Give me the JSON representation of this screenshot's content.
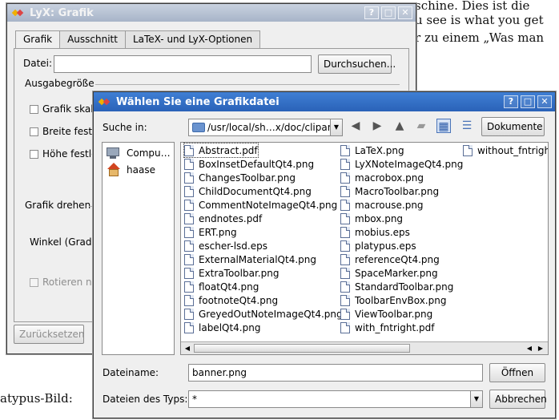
{
  "background_doc": {
    "lines": [
      "schine. Dies ist die",
      "u see is what you get",
      "r zu einem „Was man",
      "atypus-Bild:"
    ]
  },
  "back_dialog": {
    "title": "LyX: Grafik",
    "title_buttons": [
      "?",
      "□",
      "✕"
    ],
    "tabs": [
      "Grafik",
      "Ausschnitt",
      "LaTeX- und LyX-Optionen"
    ],
    "file_label": "Datei:",
    "file_value": "",
    "browse_button": "Durchsuchen...",
    "output_size_group": "Ausgabegröße",
    "checkboxes": [
      "Grafik skal",
      "Breite festle",
      "Höhe festle"
    ],
    "rotate_group": "Grafik drehen",
    "angle_label": "Winkel (Grad)",
    "rotate_check": "Rotieren na",
    "reset_button": "Zurücksetzen"
  },
  "file_dialog": {
    "title": "Wählen Sie eine Grafikdatei",
    "title_buttons": [
      "?",
      "□",
      "✕"
    ],
    "look_in_label": "Suche in:",
    "look_in_value": "/usr/local/sh…x/doc/clipart",
    "documents_button": "Dokumente",
    "sidebar": [
      "Compu…",
      "haase"
    ],
    "files": [
      "Abstract.pdf",
      "BoxInsetDefaultQt4.png",
      "ChangesToolbar.png",
      "ChildDocumentQt4.png",
      "CommentNoteImageQt4.png",
      "endnotes.pdf",
      "ERT.png",
      "escher-lsd.eps",
      "ExternalMaterialQt4.png",
      "ExtraToolbar.png",
      "floatQt4.png",
      "footnoteQt4.png",
      "GreyedOutNoteImageQt4.png",
      "labelQt4.png",
      "LaTeX.png",
      "LyXNoteImageQt4.png",
      "macrobox.png",
      "MacroToolbar.png",
      "macrouse.png",
      "mbox.png",
      "mobius.eps",
      "platypus.eps",
      "referenceQt4.png",
      "SpaceMarker.png",
      "StandardToolbar.png",
      "ToolbarEnvBox.png",
      "ViewToolbar.png",
      "with_fntright.pdf",
      "without_fntrigh"
    ],
    "selected_file": "Abstract.pdf",
    "filename_label": "Dateiname:",
    "filename_value": "banner.png",
    "open_button": "Öffnen",
    "filetype_label": "Dateien des Typs:",
    "filetype_value": "*",
    "cancel_button": "Abbrechen"
  }
}
